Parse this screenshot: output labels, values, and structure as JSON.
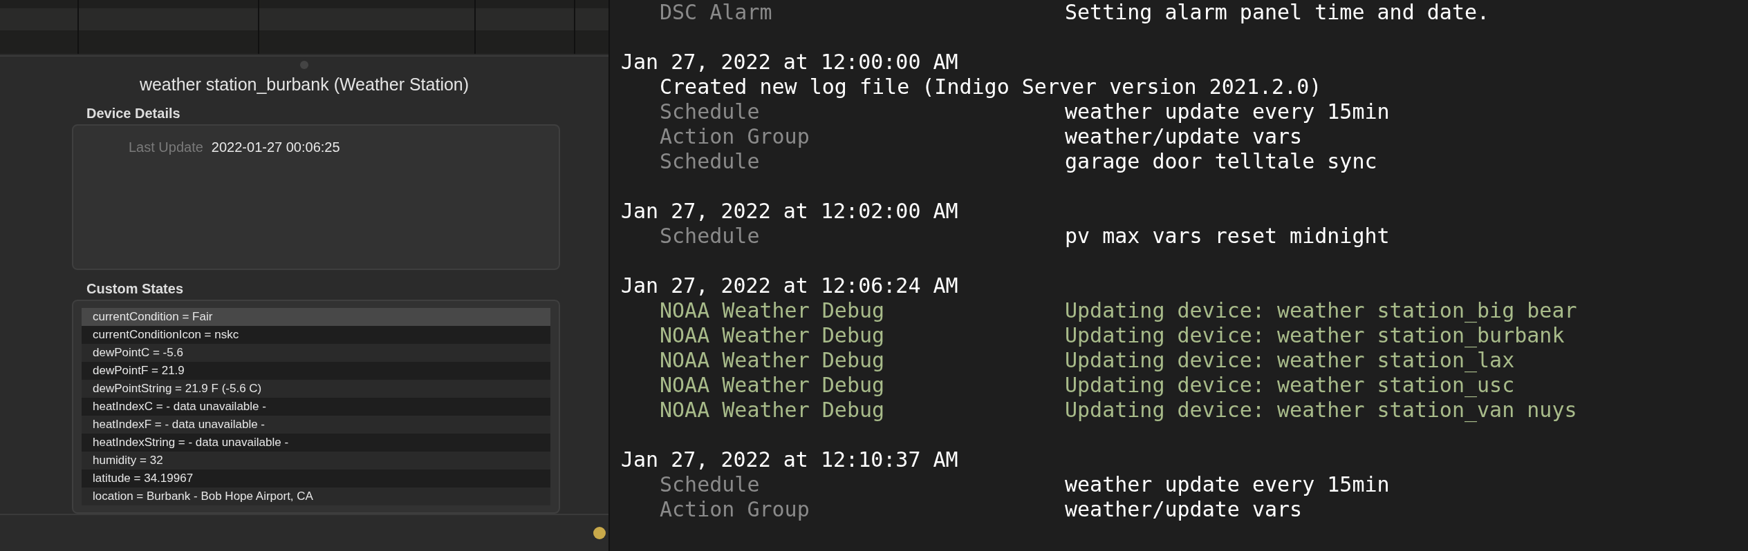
{
  "device": {
    "title": "weather station_burbank (Weather Station)",
    "details_heading": "Device Details",
    "details": [
      {
        "label": "Last Update",
        "value": "2022-01-27 00:06:25"
      }
    ],
    "states_heading": "Custom States",
    "states": [
      {
        "text": "currentCondition = Fair",
        "selected": true
      },
      {
        "text": "currentConditionIcon = nskc",
        "selected": false
      },
      {
        "text": "dewPointC = -5.6",
        "selected": false
      },
      {
        "text": "dewPointF = 21.9",
        "selected": false
      },
      {
        "text": "dewPointString = 21.9 F (-5.6 C)",
        "selected": false
      },
      {
        "text": "heatIndexC = - data unavailable -",
        "selected": false
      },
      {
        "text": "heatIndexF = - data unavailable -",
        "selected": false
      },
      {
        "text": "heatIndexString = - data unavailable -",
        "selected": false
      },
      {
        "text": "humidity = 32",
        "selected": false
      },
      {
        "text": "latitude = 34.19967",
        "selected": false
      },
      {
        "text": "location = Burbank - Bob Hope Airport, CA",
        "selected": false
      }
    ]
  },
  "log": [
    {
      "lines": [
        {
          "kind": "event",
          "source": "DSC Alarm",
          "message": "Setting alarm panel time and date."
        }
      ]
    },
    {
      "timestamp": "Jan 27, 2022 at 12:00:00 AM",
      "lines": [
        {
          "kind": "note",
          "message": "Created new log file (Indigo Server version 2021.2.0)"
        },
        {
          "kind": "event",
          "source": "Schedule",
          "message": "weather update every 15min"
        },
        {
          "kind": "event",
          "source": "Action Group",
          "message": "weather/update vars"
        },
        {
          "kind": "event",
          "source": "Schedule",
          "message": "garage door telltale sync"
        }
      ]
    },
    {
      "timestamp": "Jan 27, 2022 at 12:02:00 AM",
      "lines": [
        {
          "kind": "event",
          "source": "Schedule",
          "message": "pv max vars reset midnight"
        }
      ]
    },
    {
      "timestamp": "Jan 27, 2022 at 12:06:24 AM",
      "lines": [
        {
          "kind": "debug",
          "source": "NOAA Weather Debug",
          "message": "Updating device: weather station_big bear"
        },
        {
          "kind": "debug",
          "source": "NOAA Weather Debug",
          "message": "Updating device: weather station_burbank"
        },
        {
          "kind": "debug",
          "source": "NOAA Weather Debug",
          "message": "Updating device: weather station_lax"
        },
        {
          "kind": "debug",
          "source": "NOAA Weather Debug",
          "message": "Updating device: weather station_usc"
        },
        {
          "kind": "debug",
          "source": "NOAA Weather Debug",
          "message": "Updating device: weather station_van nuys"
        }
      ]
    },
    {
      "timestamp": "Jan 27, 2022 at 12:10:37 AM",
      "lines": [
        {
          "kind": "event",
          "source": "Schedule",
          "message": "weather update every 15min"
        },
        {
          "kind": "event",
          "source": "Action Group",
          "message": "weather/update vars"
        }
      ]
    }
  ]
}
